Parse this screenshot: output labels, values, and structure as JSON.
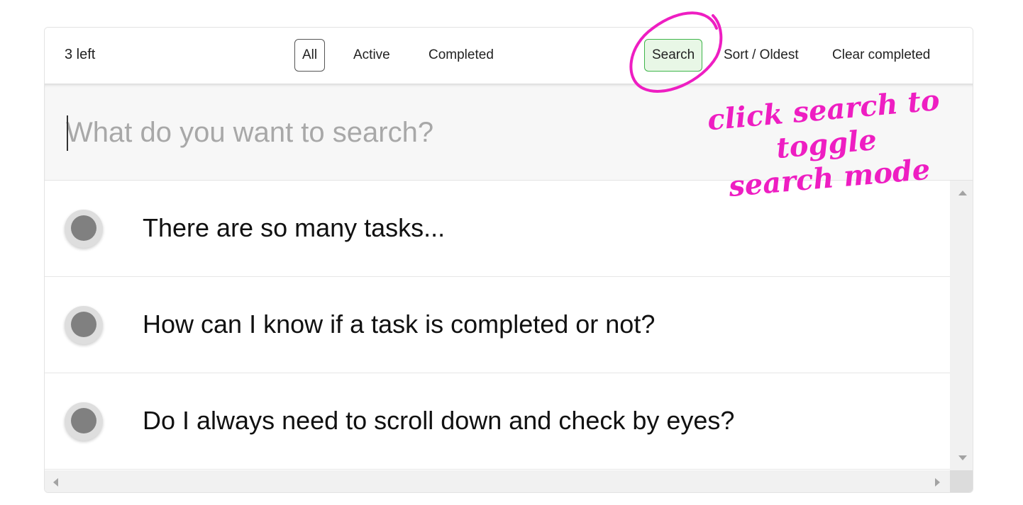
{
  "toolbar": {
    "count_label": "3 left",
    "filters": [
      "All",
      "Active",
      "Completed"
    ],
    "selected_filter": "All",
    "search_label": "Search",
    "search_active": true,
    "sort_label": "Sort / Oldest",
    "clear_label": "Clear completed"
  },
  "search": {
    "placeholder": "What do you want to search?",
    "value": ""
  },
  "tasks": [
    {
      "text": "There are so many tasks...",
      "completed": false
    },
    {
      "text": "How can I know if a task is completed or not?",
      "completed": false
    },
    {
      "text": "Do I always need to scroll down and check by eyes?",
      "completed": false
    }
  ],
  "annotation": {
    "text_line1": "click search to toggle",
    "text_line2": "search mode",
    "color": "#ee1ec2"
  },
  "colors": {
    "search_active_bg": "#e8f7e6",
    "search_active_border": "#3fb54a",
    "toggle_dot": "#808080"
  }
}
